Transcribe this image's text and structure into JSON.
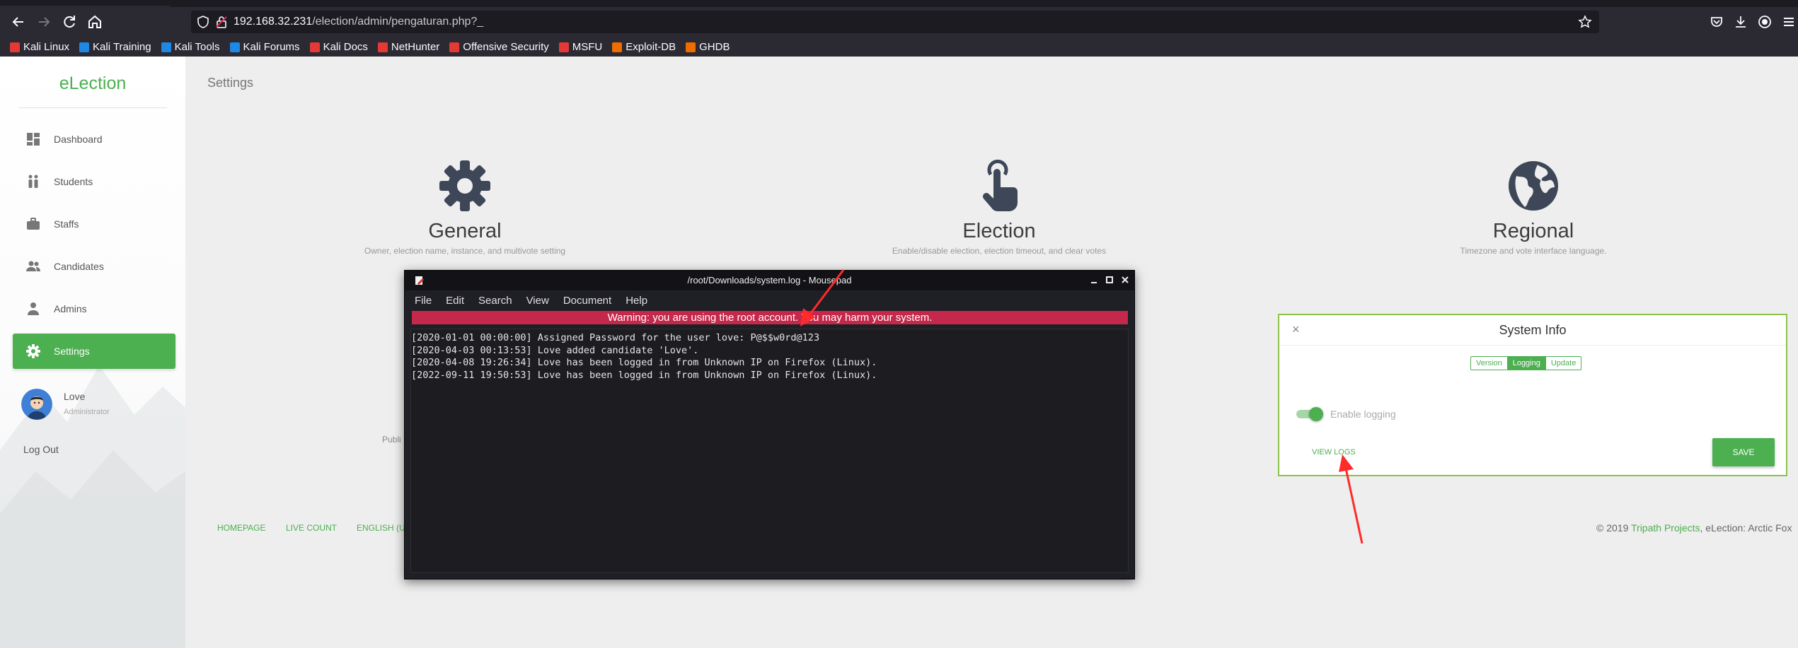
{
  "browser": {
    "url_host": "192.168.32.231",
    "url_path": "/election/admin/pengaturan.php?_",
    "bookmarks": [
      {
        "label": "Kali Linux",
        "icon": "kali-icon",
        "color": "#e53935"
      },
      {
        "label": "Kali Training",
        "icon": "kali-training-icon",
        "color": "#1e88e5"
      },
      {
        "label": "Kali Tools",
        "icon": "kali-tools-icon",
        "color": "#1e88e5"
      },
      {
        "label": "Kali Forums",
        "icon": "kali-forums-icon",
        "color": "#1e88e5"
      },
      {
        "label": "Kali Docs",
        "icon": "kali-docs-icon",
        "color": "#e53935"
      },
      {
        "label": "NetHunter",
        "icon": "nethunter-icon",
        "color": "#e53935"
      },
      {
        "label": "Offensive Security",
        "icon": "offsec-icon",
        "color": "#e53935"
      },
      {
        "label": "MSFU",
        "icon": "msfu-icon",
        "color": "#e53935"
      },
      {
        "label": "Exploit-DB",
        "icon": "exploit-db-icon",
        "color": "#ef6c00"
      },
      {
        "label": "GHDB",
        "icon": "ghdb-icon",
        "color": "#ef6c00"
      }
    ]
  },
  "sidebar": {
    "brand": "eLection",
    "items": [
      {
        "label": "Dashboard",
        "icon": "dashboard-icon"
      },
      {
        "label": "Students",
        "icon": "students-icon"
      },
      {
        "label": "Staffs",
        "icon": "briefcase-icon"
      },
      {
        "label": "Candidates",
        "icon": "candidates-icon"
      },
      {
        "label": "Admins",
        "icon": "person-icon"
      },
      {
        "label": "Settings",
        "icon": "gear-icon"
      }
    ],
    "user": {
      "name": "Love",
      "role": "Administrator"
    },
    "logout": "Log Out"
  },
  "main": {
    "page_title": "Settings",
    "cards": [
      {
        "title": "General",
        "desc": "Owner, election name, instance, and multivote setting",
        "icon": "gear-icon"
      },
      {
        "title": "Election",
        "desc": "Enable/disable election, election timeout, and clear votes",
        "icon": "touch-icon"
      },
      {
        "title": "Regional",
        "desc": "Timezone and vote interface language.",
        "icon": "globe-icon"
      }
    ],
    "partial_text": "Publi",
    "footer_links": [
      "HOMEPAGE",
      "LIVE COUNT",
      "ENGLISH (U"
    ],
    "copyright_prefix": "© 2019 ",
    "copyright_link": "Tripath Projects",
    "copyright_suffix": ", eLection: Arctic Fox"
  },
  "system_info": {
    "title": "System Info",
    "close": "×",
    "tabs": [
      "Version",
      "Logging",
      "Update"
    ],
    "selected_tab": "Logging",
    "toggle_label": "Enable logging",
    "toggle_on": true,
    "view_logs": "VIEW LOGS",
    "save": "SAVE"
  },
  "mousepad": {
    "title": "/root/Downloads/system.log - Mousepad",
    "menu": [
      "File",
      "Edit",
      "Search",
      "View",
      "Document",
      "Help"
    ],
    "warning": "Warning: you are using the root account. You may harm your system.",
    "lines": [
      "[2020-01-01 00:00:00] Assigned Password for the user love: P@$$w0rd@123",
      "[2020-04-03 00:13:53] Love added candidate 'Love'.",
      "[2020-04-08 19:26:34] Love has been logged in from Unknown IP on Firefox (Linux).",
      "[2022-09-11 19:50:53] Love has been logged in from Unknown IP on Firefox (Linux)."
    ]
  },
  "colors": {
    "accent": "#4caf50",
    "warning_bar": "#c4294b",
    "annotation": "#ff2a2a"
  }
}
